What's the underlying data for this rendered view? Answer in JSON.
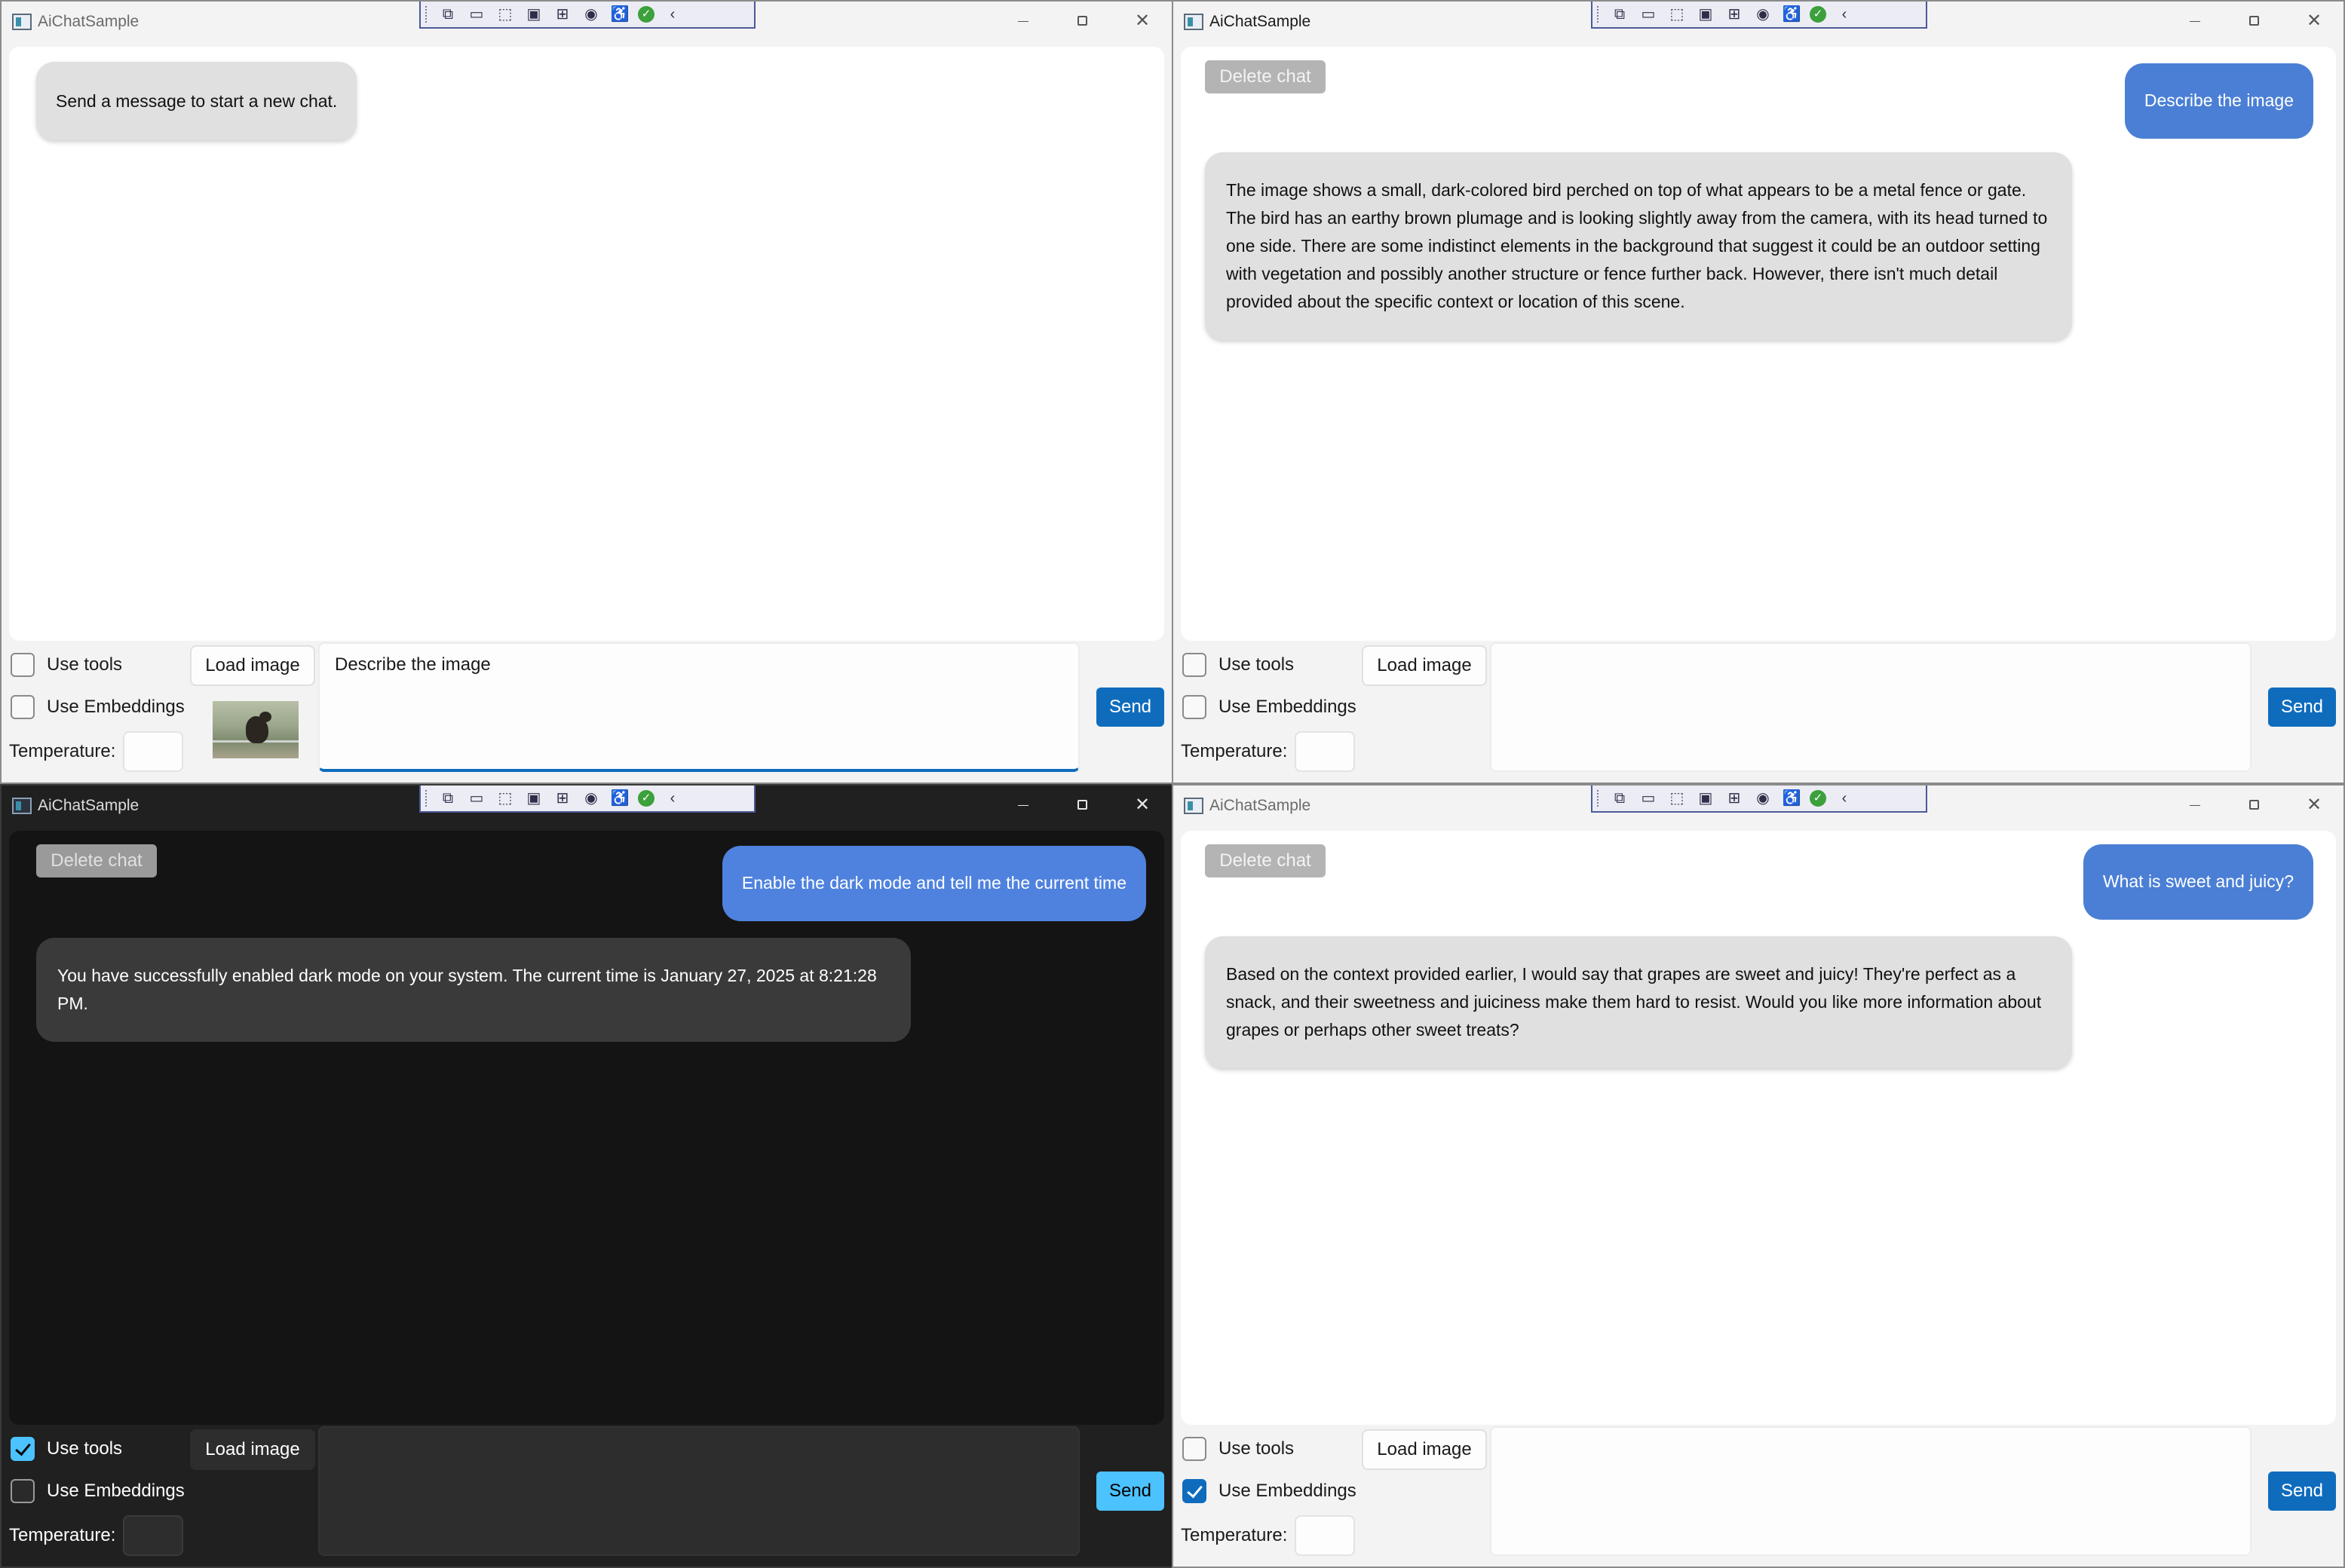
{
  "windows": [
    {
      "title": "AiChatSample",
      "theme": "light",
      "empty_message": "Send a message to start a new chat.",
      "use_tools_label": "Use tools",
      "use_tools_checked": false,
      "use_embeddings_label": "Use Embeddings",
      "use_embeddings_checked": false,
      "load_image_label": "Load image",
      "temperature_label": "Temperature:",
      "input_value": "Describe the image",
      "send_label": "Send",
      "has_image_thumbnail": true
    },
    {
      "title": "AiChatSample",
      "theme": "light",
      "delete_chat_label": "Delete chat",
      "user_message": "Describe the image",
      "ai_message": "The image shows a small, dark-colored bird perched on top of what appears to be a metal fence or gate. The bird has an earthy brown plumage and is looking slightly away from the camera, with its head turned to one side. There are some indistinct elements in the background that suggest it could be an outdoor setting with vegetation and possibly another structure or fence further back. However, there isn't much detail provided about the specific context or location of this scene.",
      "use_tools_label": "Use tools",
      "use_tools_checked": false,
      "use_embeddings_label": "Use Embeddings",
      "use_embeddings_checked": false,
      "load_image_label": "Load image",
      "temperature_label": "Temperature:",
      "input_value": "",
      "send_label": "Send"
    },
    {
      "title": "AiChatSample",
      "theme": "dark",
      "delete_chat_label": "Delete chat",
      "user_message": "Enable the dark mode and tell me the current time",
      "ai_message": "You have successfully enabled dark mode on your system. The current time is January 27, 2025 at 8:21:28 PM.",
      "use_tools_label": "Use tools",
      "use_tools_checked": true,
      "use_embeddings_label": "Use Embeddings",
      "use_embeddings_checked": false,
      "load_image_label": "Load image",
      "temperature_label": "Temperature:",
      "input_value": "",
      "send_label": "Send"
    },
    {
      "title": "AiChatSample",
      "theme": "light",
      "delete_chat_label": "Delete chat",
      "user_message": "What is sweet and juicy?",
      "ai_message": "Based on the context provided earlier, I would say that grapes are sweet and juicy! They're perfect as a snack, and their sweetness and juiciness make them hard to resist. Would you like more information about grapes or perhaps other sweet treats?",
      "use_tools_label": "Use tools",
      "use_tools_checked": false,
      "use_embeddings_label": "Use Embeddings",
      "use_embeddings_checked": true,
      "load_image_label": "Load image",
      "temperature_label": "Temperature:",
      "input_value": "",
      "send_label": "Send"
    }
  ],
  "debug_toolbar": {
    "icons": [
      "live-visual-tree-icon",
      "record-icon",
      "select-element-icon",
      "display-layout-adorners-icon",
      "track-focus-icon",
      "binding-failures-icon",
      "accessibility-checker-icon",
      "checkmark-icon",
      "collapse-chevron-icon"
    ]
  },
  "colors": {
    "accent_light": "#0f6cbd",
    "accent_dark": "#4cc2ff",
    "user_bubble": "#4b7fd6",
    "ai_bubble_light": "#e0e0e0",
    "ai_bubble_dark": "#3a3a3a"
  }
}
